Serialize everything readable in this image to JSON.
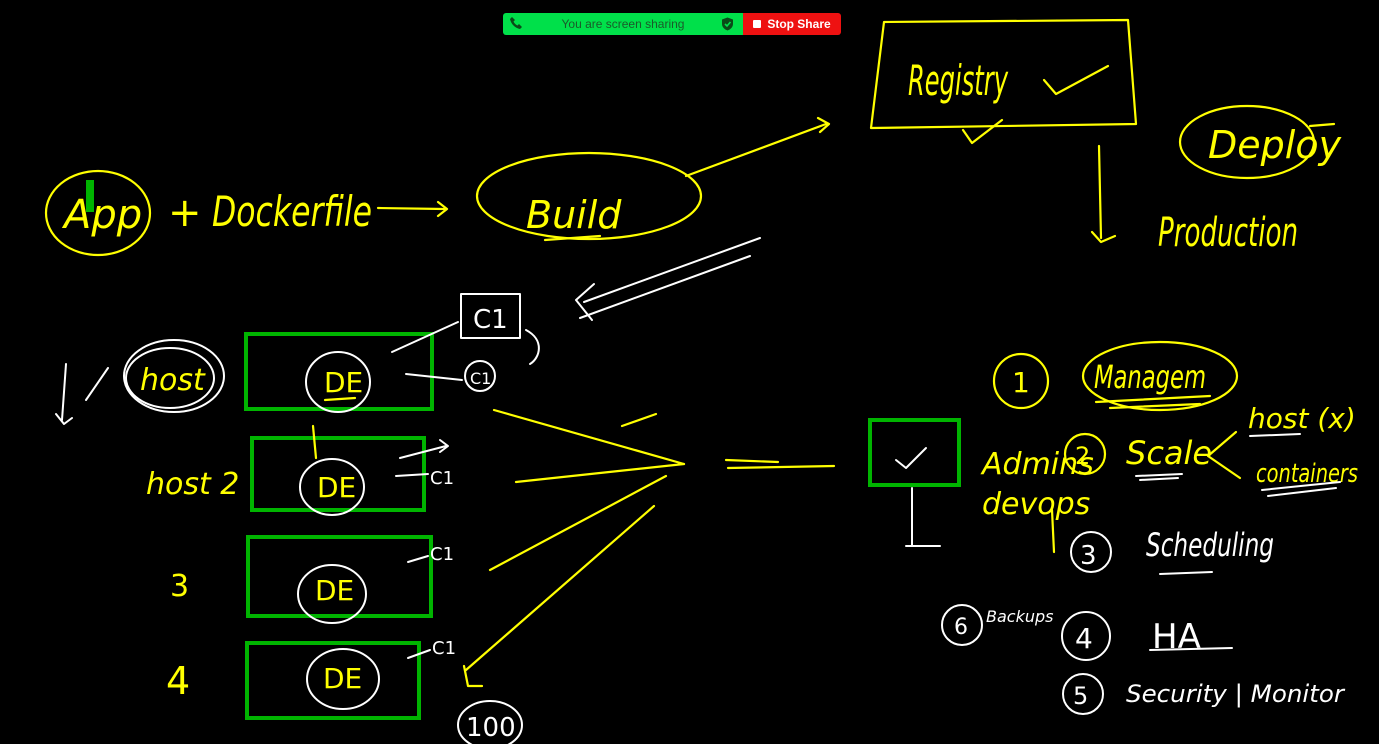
{
  "share_bar": {
    "status": "You are screen sharing",
    "stop_label": "Stop Share",
    "status_color": "#00e04a",
    "stop_color": "#ee1111"
  },
  "whiteboard": {
    "background": "#000000",
    "ink_yellow": "#ffff00",
    "ink_white": "#ffffff",
    "ink_green": "#00b400",
    "top_row": {
      "app": "App",
      "plus": "+",
      "dockerfile": "Dockerfile",
      "build": "Build",
      "registry": "Registry",
      "deploy": "Deploy",
      "production": "Production"
    },
    "hosts": [
      "host",
      "host 2",
      "3",
      "4"
    ],
    "engine_label": "DE",
    "container_label": "C1",
    "hundred": "100",
    "manage": {
      "n1": "1",
      "title": "Managem",
      "admins": "Admins",
      "devops": "devops",
      "n2": "2",
      "scale": "Scale",
      "host_x": "host (x)",
      "containers": "containers",
      "n3": "3",
      "scheduling": "Scheduling",
      "n4": "4",
      "ha": "HA",
      "n5": "5",
      "security": "Security | Monitor",
      "n6": "6",
      "backups": "Backups"
    }
  }
}
